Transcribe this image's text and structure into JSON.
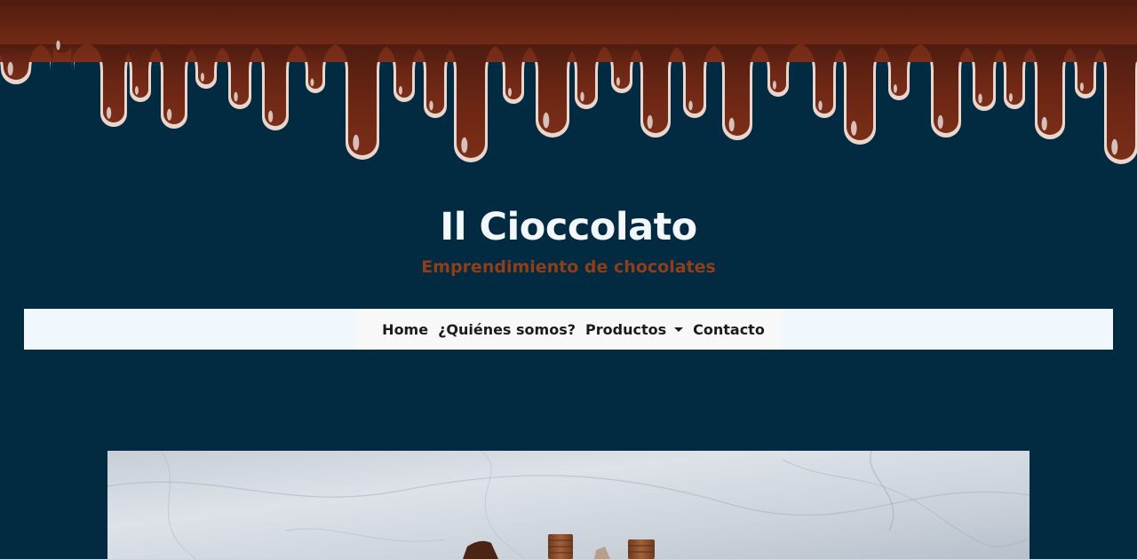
{
  "header": {
    "title": "Il Cioccolato",
    "subtitle": "Emprendimiento de chocolates"
  },
  "nav": {
    "items": [
      {
        "label": "Home"
      },
      {
        "label": "¿Quiénes somos?"
      },
      {
        "label": "Productos"
      },
      {
        "label": "Contacto"
      }
    ]
  },
  "colors": {
    "background": "#022a41",
    "chocolate": "#5a2112",
    "title": "#f1f7fc",
    "subtitle": "#8f3e18",
    "navbar": "#f0f7fd"
  }
}
